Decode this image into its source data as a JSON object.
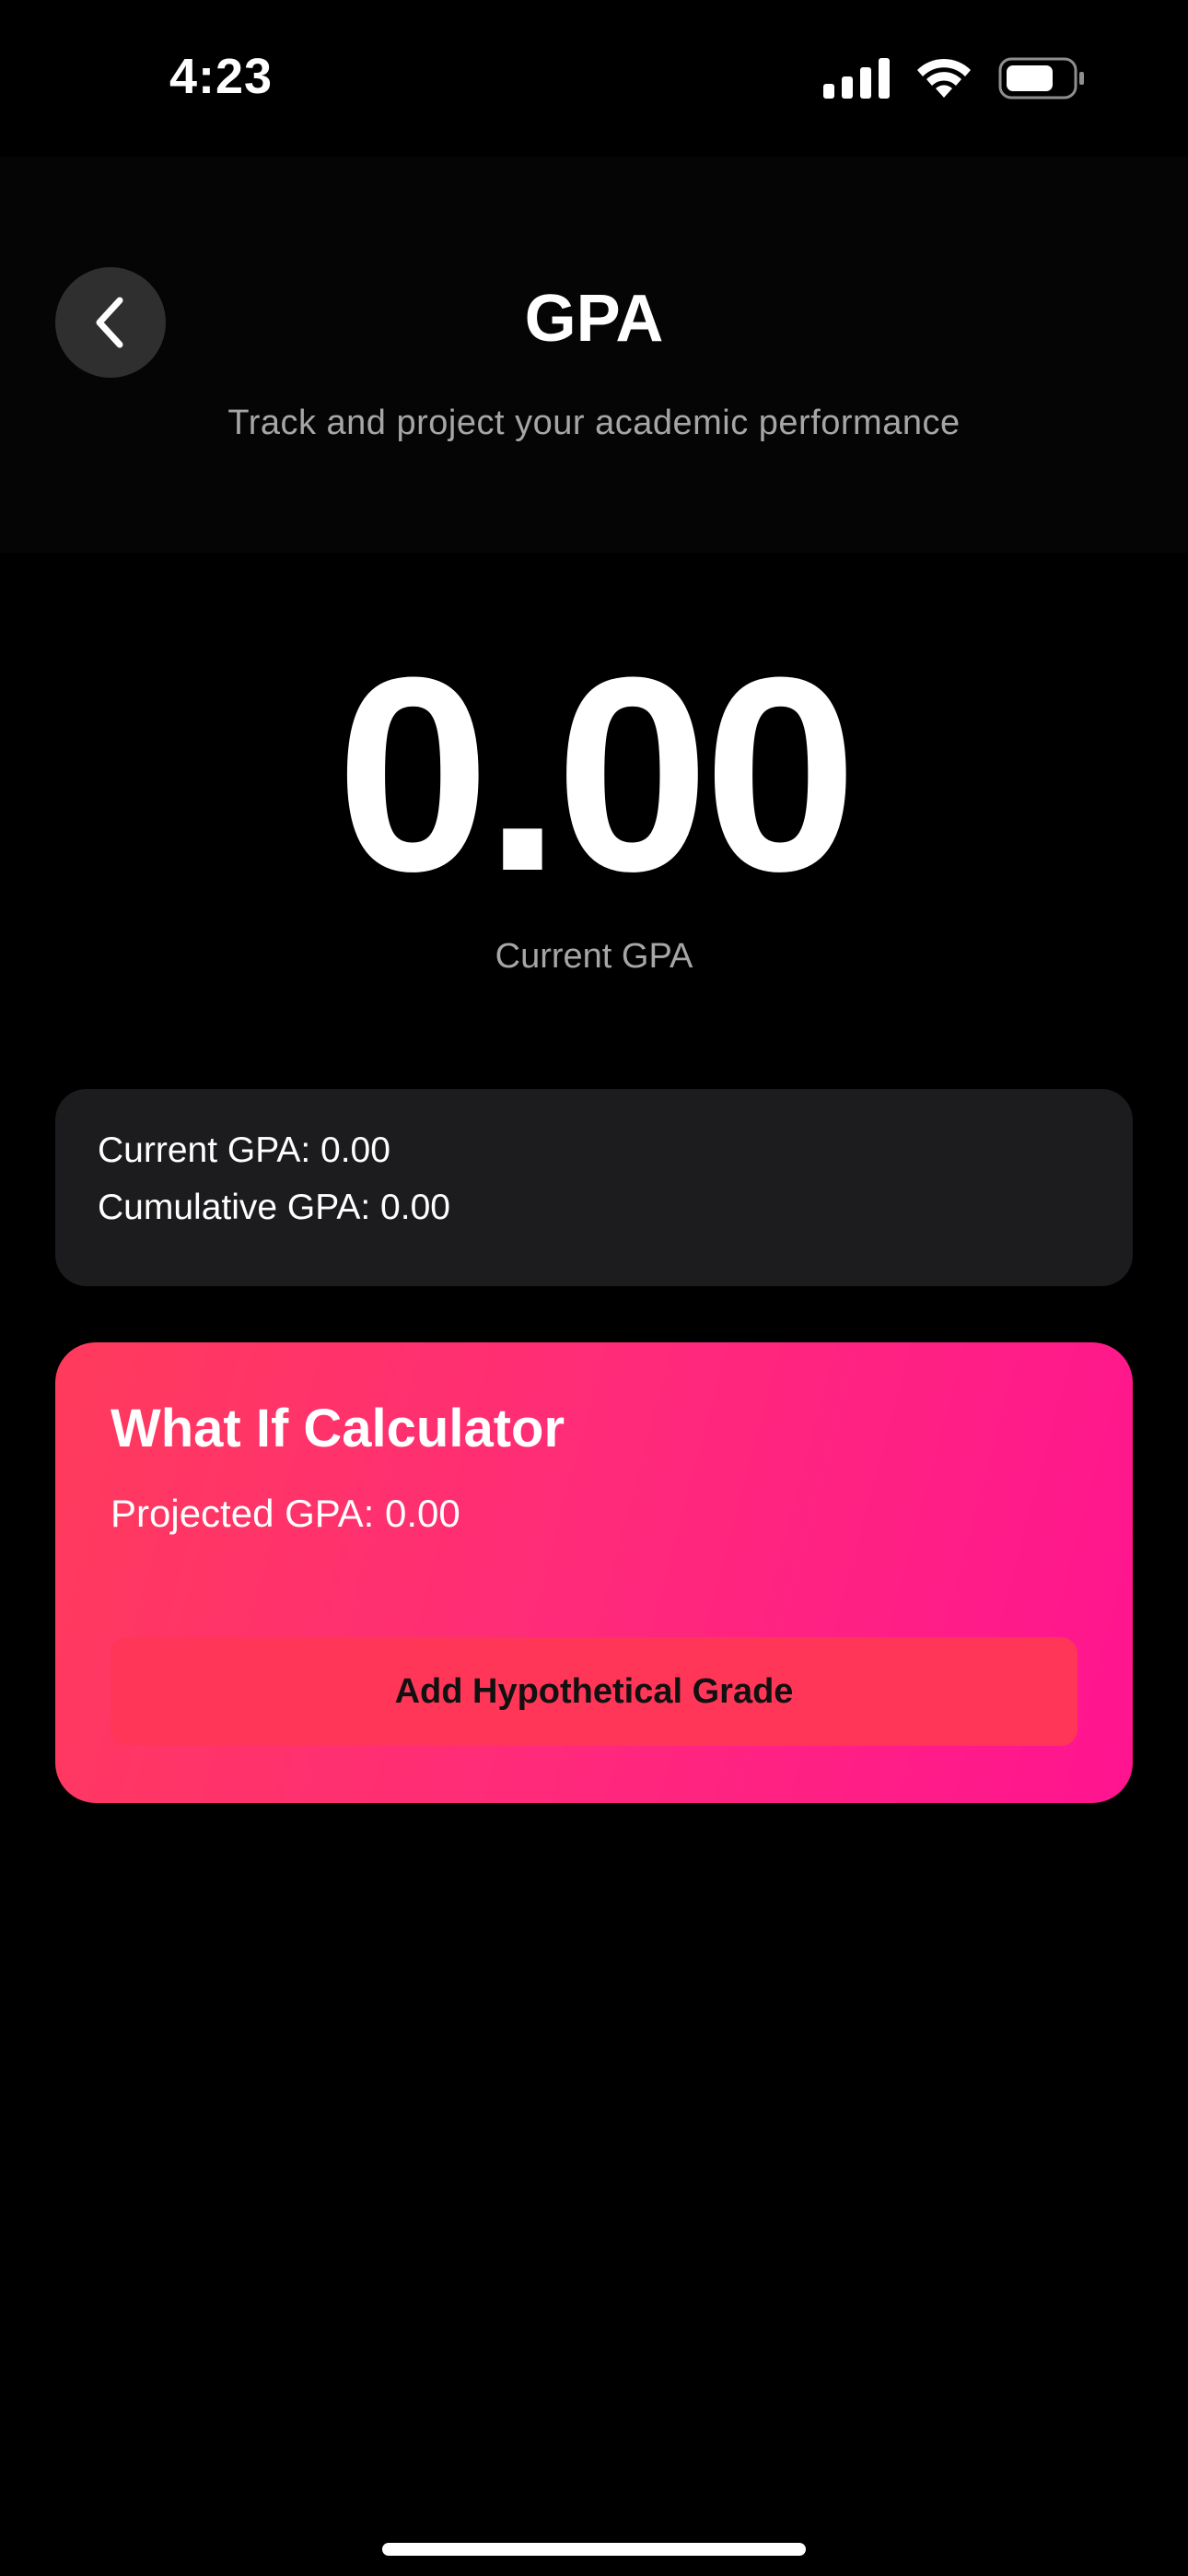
{
  "status_bar": {
    "time": "4:23"
  },
  "header": {
    "title": "GPA",
    "subtitle": "Track and project your academic performance",
    "back_icon": "chevron-left-icon"
  },
  "gpa_display": {
    "value": "0.00",
    "caption": "Current GPA"
  },
  "summary": {
    "current_gpa": "Current GPA: 0.00",
    "cumulative_gpa": "Cumulative GPA: 0.00"
  },
  "what_if": {
    "title": "What If Calculator",
    "projected_gpa": "Projected GPA: 0.00",
    "button_label": "Add Hypothetical Grade"
  },
  "colors": {
    "background": "#000000",
    "card": "#1c1c1e",
    "gradient_start": "#ff3b5c",
    "gradient_end": "#ff1490",
    "button": "#ff3657"
  }
}
